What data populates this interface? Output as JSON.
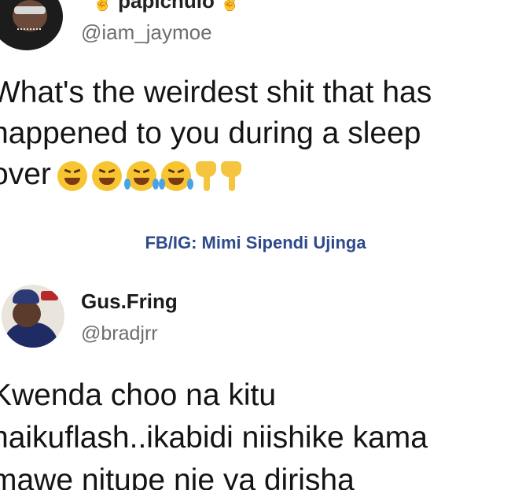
{
  "tweets": [
    {
      "display_name": "papichulo",
      "handle": "@iam_jaymoe",
      "text_lines": [
        "What's the weirdest shit that has",
        "happened  to you during  a sleep",
        "over"
      ],
      "emojis": [
        "tired-face",
        "tired-face",
        "tears-of-joy",
        "tears-of-joy",
        "pointing-down",
        "pointing-down"
      ]
    },
    {
      "display_name": "Gus.Fring",
      "handle": "@bradjrr",
      "text_lines": [
        "Kwenda choo na kitu",
        "haikuflash..ikabidi niishike kama",
        "mawe nitupe nje ya dirisha"
      ]
    }
  ],
  "watermark": "FB/IG: Mimi Sipendi Ujinga",
  "colors": {
    "watermark": "#2e4a8c",
    "handle": "#6e6e6e",
    "text": "#141414"
  }
}
